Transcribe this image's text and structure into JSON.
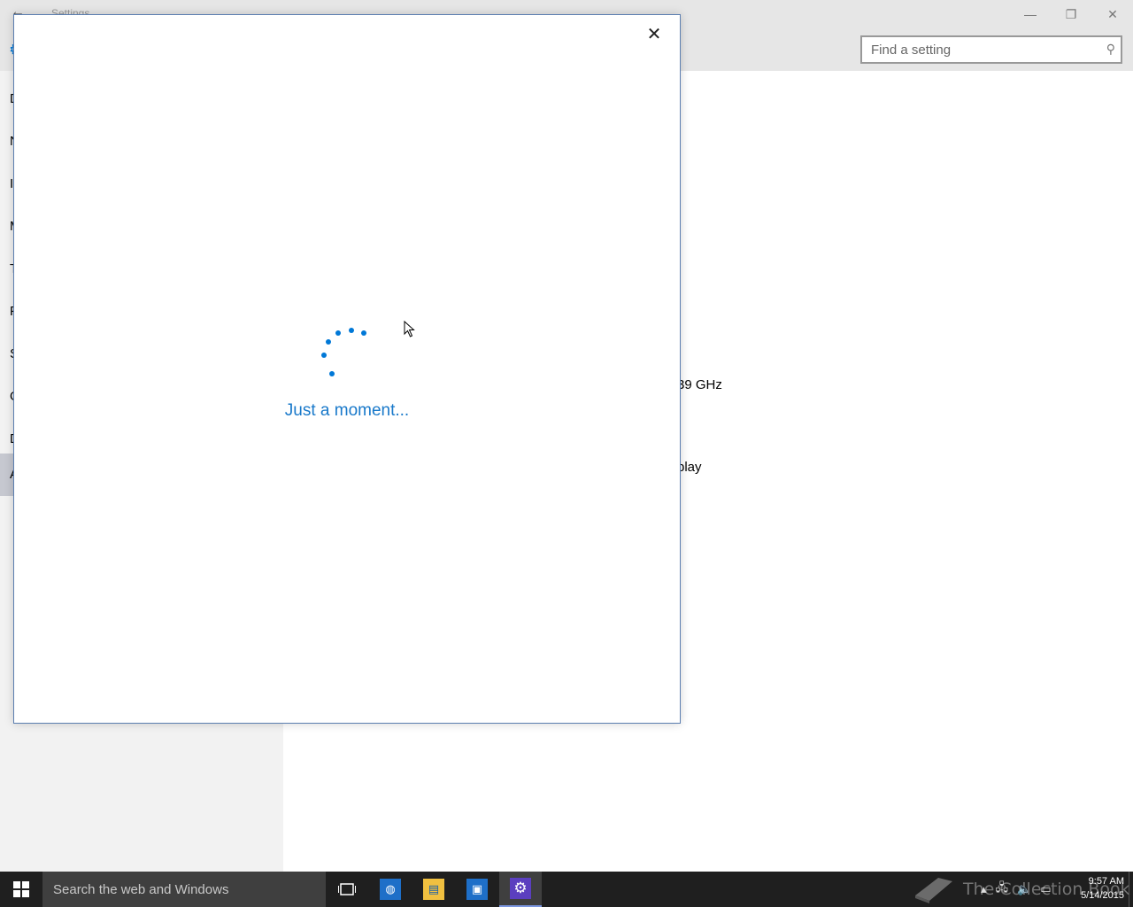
{
  "window": {
    "title": "Settings",
    "back_icon": "back-arrow-icon",
    "controls": {
      "minimize": "—",
      "restore": "❐",
      "close": "✕"
    }
  },
  "header": {
    "search_placeholder": "Find a setting"
  },
  "sidebar": {
    "items": [
      {
        "label": "D"
      },
      {
        "label": "N"
      },
      {
        "label": "I"
      },
      {
        "label": "M"
      },
      {
        "label": "T"
      },
      {
        "label": "P"
      },
      {
        "label": "S"
      },
      {
        "label": "O"
      },
      {
        "label": "D"
      },
      {
        "label": "A",
        "active": true
      }
    ]
  },
  "main": {
    "processor_speed_fragment": "39 GHz",
    "pen_touch_fragment": "play"
  },
  "dialog": {
    "close_label": "✕",
    "loading_text": "Just a moment...",
    "accent_color": "#0078d7"
  },
  "taskbar": {
    "search_text": "Search the web and Windows",
    "apps": [
      "task-view",
      "edge",
      "file-explorer",
      "store",
      "settings"
    ],
    "active_app": "settings",
    "clock": {
      "time": "9:57 AM",
      "date": "5/14/2015"
    },
    "watermark_text": "The Collection Book"
  }
}
